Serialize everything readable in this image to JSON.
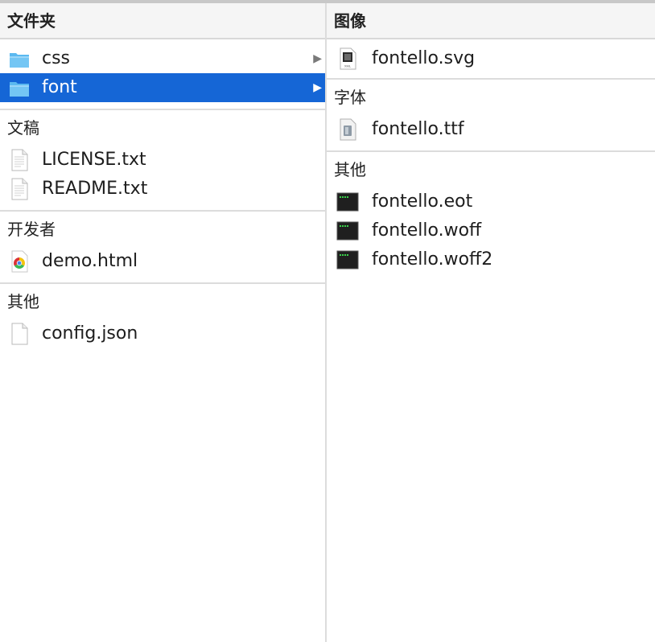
{
  "left": {
    "header": "文件夹",
    "folders": [
      {
        "label": "css",
        "selected": false
      },
      {
        "label": "font",
        "selected": true
      }
    ],
    "groups": [
      {
        "title": "文稿",
        "items": [
          {
            "label": "LICENSE.txt"
          },
          {
            "label": "README.txt"
          }
        ]
      },
      {
        "title": "开发者",
        "items": [
          {
            "label": "demo.html"
          }
        ]
      },
      {
        "title": "其他",
        "items": [
          {
            "label": "config.json"
          }
        ]
      }
    ]
  },
  "right": {
    "header": "图像",
    "image_items": [
      {
        "label": "fontello.svg",
        "icon_caption": "XML"
      }
    ],
    "groups": [
      {
        "title": "字体",
        "items": [
          {
            "label": "fontello.ttf"
          }
        ]
      },
      {
        "title": "其他",
        "items": [
          {
            "label": "fontello.eot"
          },
          {
            "label": "fontello.woff"
          },
          {
            "label": "fontello.woff2"
          }
        ]
      }
    ]
  },
  "colors": {
    "selection": "#1566d6",
    "folder": "#5bb9f0"
  },
  "icons": {
    "folder": "folder-icon",
    "text_doc": "text-document-icon",
    "chrome": "chrome-html-icon",
    "blank": "blank-document-icon",
    "svg": "svg-xml-document-icon",
    "font": "font-file-icon",
    "terminal": "terminal-exec-icon",
    "disclosure": "disclosure-arrow-icon"
  }
}
